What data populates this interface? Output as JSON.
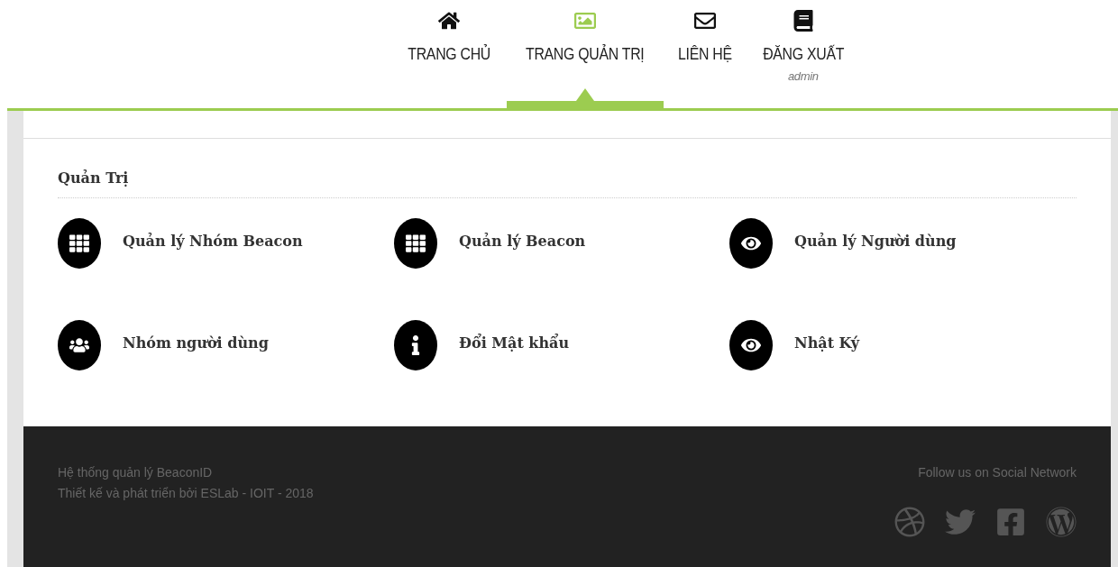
{
  "nav": {
    "items": [
      {
        "label": "TRANG CHỦ",
        "selected": false
      },
      {
        "label": "TRANG QUẢN TRỊ",
        "selected": true
      },
      {
        "label": "LIÊN HỆ",
        "selected": false
      },
      {
        "label": "ĐĂNG XUẤT",
        "selected": false,
        "subtitle": "admin"
      }
    ]
  },
  "section": {
    "title": "Quản Trị",
    "items": [
      {
        "label": "Quản lý Nhóm Beacon"
      },
      {
        "label": "Quản lý Beacon"
      },
      {
        "label": "Quản lý Người dùng"
      },
      {
        "label": "Nhóm người dùng"
      },
      {
        "label": "Đổi Mật khẩu"
      },
      {
        "label": "Nhật Ký"
      }
    ]
  },
  "footer": {
    "lines": [
      "Hệ thống quản lý BeaconID",
      "Thiết kế và phát triển bởi ESLab - IOIT - 2018"
    ],
    "social_title": "Follow us on Social Network"
  }
}
